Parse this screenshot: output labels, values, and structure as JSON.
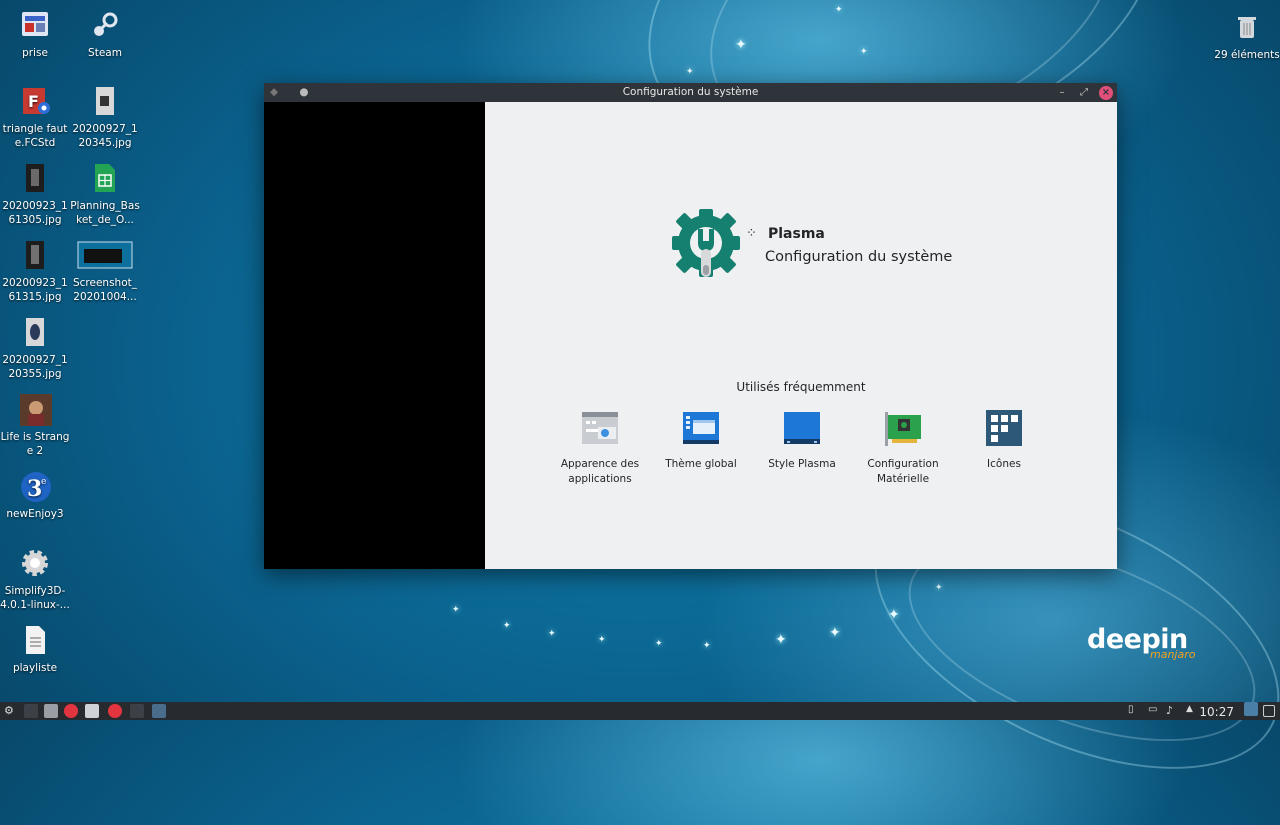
{
  "window": {
    "title": "Configuration du système",
    "hero_title": "Plasma",
    "hero_subtitle": "Configuration du système",
    "frequently_used_title": "Utilisés fréquemment",
    "frequent_items": [
      {
        "label": "Apparence des applications",
        "icon": "application-appearance-icon"
      },
      {
        "label": "Thème global",
        "icon": "global-theme-icon"
      },
      {
        "label": "Style Plasma",
        "icon": "plasma-style-icon"
      },
      {
        "label": "Configuration Matérielle",
        "icon": "hardware-config-icon"
      },
      {
        "label": "Icônes",
        "icon": "icons-settings-icon"
      }
    ]
  },
  "desktop": {
    "icons": [
      {
        "label": "prise",
        "icon": "image-file-icon"
      },
      {
        "label": "Steam",
        "icon": "steam-icon"
      },
      {
        "label": "triangle faute.FCStd",
        "icon": "freecad-file-icon"
      },
      {
        "label": "20200927_120345.jpg",
        "icon": "photo-icon"
      },
      {
        "label": "20200923_161305.jpg",
        "icon": "photo-icon"
      },
      {
        "label": "Planning_Basket_de_O...",
        "icon": "spreadsheet-icon"
      },
      {
        "label": "20200923_161315.jpg",
        "icon": "photo-icon"
      },
      {
        "label": "Screenshot_20201004...",
        "icon": "screenshot-icon"
      },
      {
        "label": "20200927_120355.jpg",
        "icon": "photo-icon"
      },
      {
        "label": "Life is Strange 2",
        "icon": "game-icon"
      },
      {
        "label": "newEnjoy3",
        "icon": "app-icon"
      },
      {
        "label": "Simplify3D-4.0.1-linux-...",
        "icon": "gear-icon"
      },
      {
        "label": "playliste",
        "icon": "text-file-icon"
      }
    ],
    "trash_label": "29 éléments",
    "wallpaper_brand": "deepin",
    "wallpaper_sub": "manjaro",
    "new_enjoy_glyph": "3",
    "new_enjoy_sup": "e"
  },
  "taskbar": {
    "clock": "10:27"
  },
  "colors": {
    "accent_teal": "#15806f",
    "titlebar": "#2f343a",
    "close_button": "#e0507a",
    "taskbar": "#272b30"
  }
}
